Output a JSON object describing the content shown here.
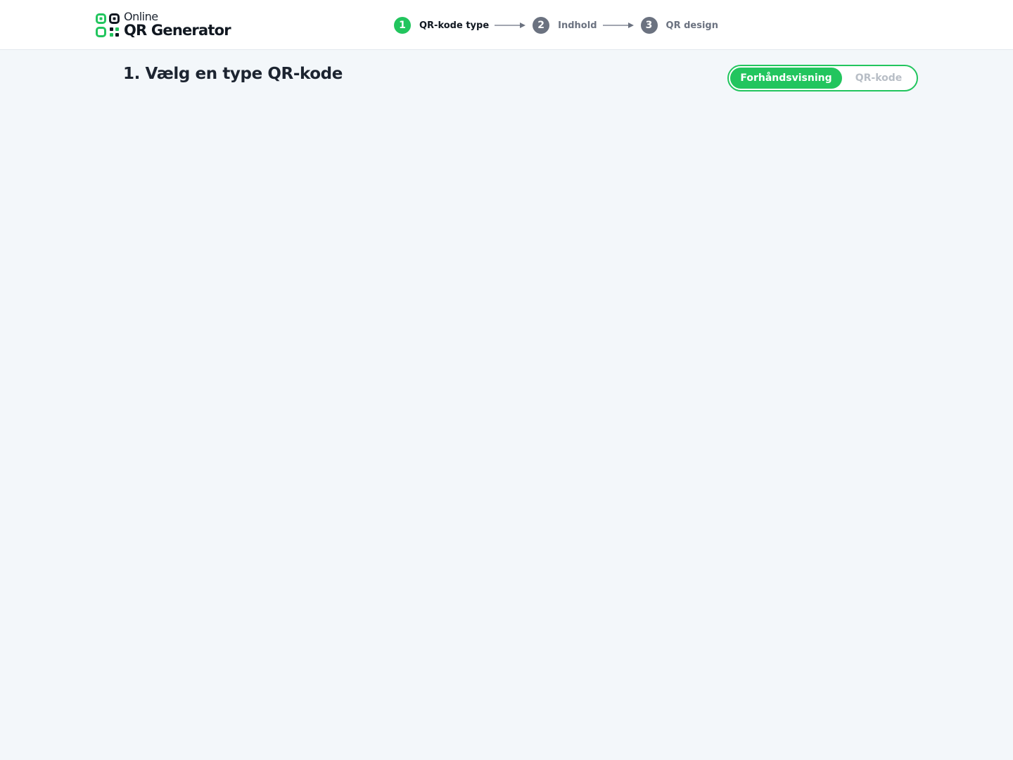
{
  "brand": {
    "line1": "Online",
    "line2": "QR Generator",
    "logo_icon": "qr-logo-icon",
    "accent_color": "#22c55e"
  },
  "steps": [
    {
      "number": "1",
      "label": "QR-kode type",
      "state": "active"
    },
    {
      "number": "2",
      "label": "Indhold",
      "state": "inactive"
    },
    {
      "number": "3",
      "label": "QR design",
      "state": "inactive"
    }
  ],
  "main": {
    "title": "1. Vælg en type QR-kode"
  },
  "view_toggle": {
    "options": [
      "Forhåndsvisning",
      "QR-kode"
    ],
    "selected": "Forhåndsvisning"
  }
}
